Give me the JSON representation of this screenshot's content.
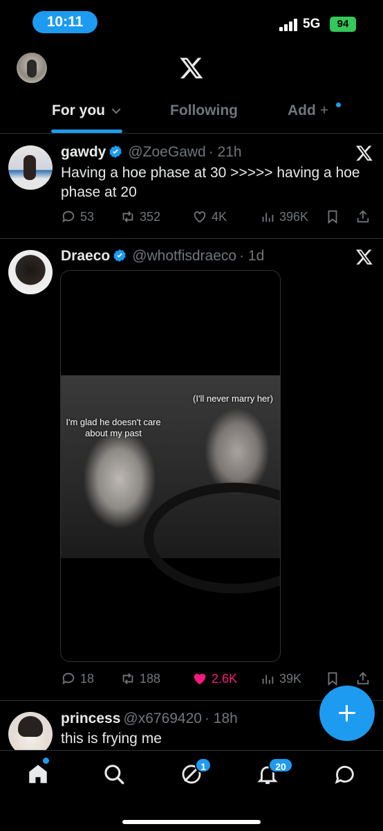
{
  "status_bar": {
    "time": "10:11",
    "network": "5G",
    "battery": "94"
  },
  "header": {
    "logo_icon": "x-logo-icon",
    "tabs": [
      {
        "label": "For you",
        "active": true
      },
      {
        "label": "Following",
        "active": false
      },
      {
        "label": "Add",
        "active": false
      }
    ]
  },
  "tweets": [
    {
      "name": "gawdy",
      "handle": "@ZoeGawd",
      "time": "· 21h",
      "text": "Having a hoe phase at 30 >>>>> having a hoe phase at 20",
      "replies": "53",
      "reposts": "352",
      "likes": "4K",
      "views": "396K"
    },
    {
      "name": "Draeco",
      "handle": "@whotfisdraeco",
      "time": "· 1d",
      "text": "",
      "media": {
        "caption_left": "I'm glad he doesn't care about my past",
        "caption_right": "(I'll never marry her)"
      },
      "replies": "18",
      "reposts": "188",
      "likes": "2.6K",
      "liked": true,
      "views": "39K"
    },
    {
      "name": "princess",
      "handle": "@x6769420",
      "time": "· 18h",
      "text": "this is frying me"
    }
  ],
  "bottom_nav": {
    "items": [
      "home-icon",
      "search-icon",
      "grok-icon",
      "notifications-icon",
      "messages-icon"
    ],
    "grok_badge": "1",
    "notifications_badge": "20"
  },
  "colors": {
    "accent": "#1d9bf0",
    "like": "#f91880",
    "muted": "#71767b",
    "battery": "#34c759"
  }
}
